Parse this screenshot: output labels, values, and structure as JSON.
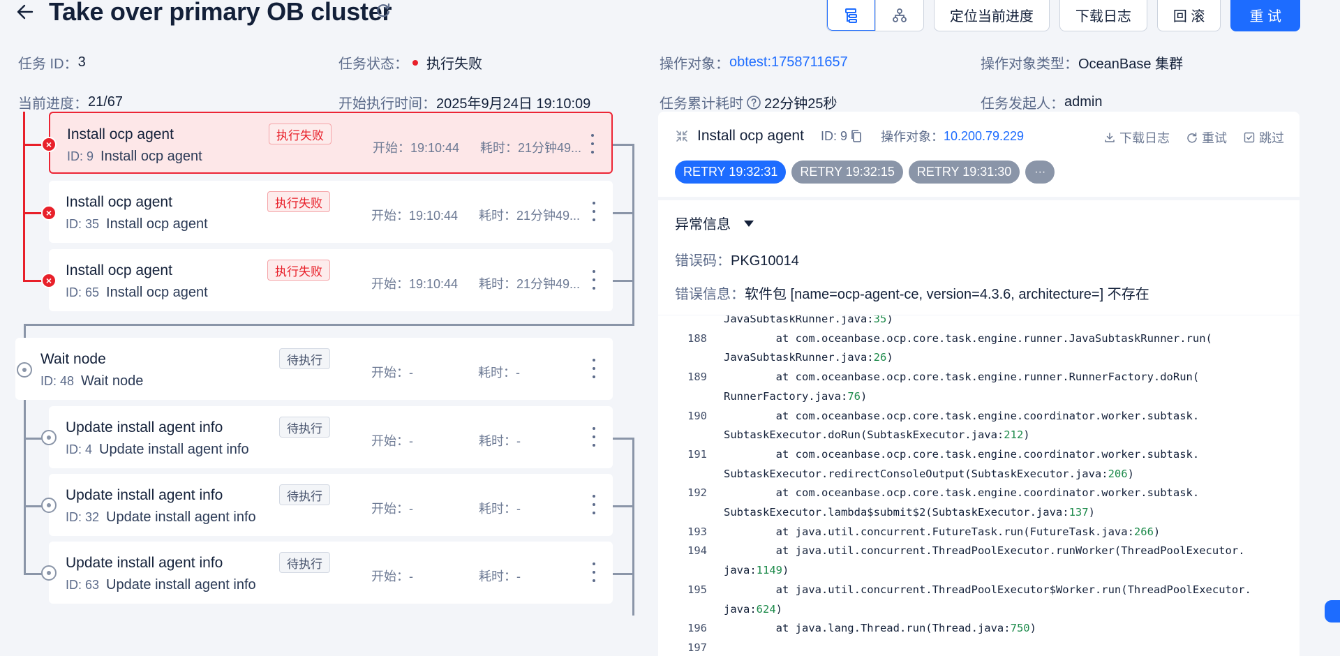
{
  "header": {
    "title": "Take over primary OB cluster",
    "buttons": {
      "locate": "定位当前进度",
      "download": "下载日志",
      "rollback": "回 滚",
      "retry": "重 试"
    }
  },
  "info": {
    "task_id_label": "任务 ID：",
    "task_id": "3",
    "status_label": "任务状态：",
    "status": "执行失败",
    "target_label": "操作对象：",
    "target": "obtest:1758711657",
    "target_type_label": "操作对象类型：",
    "target_type": "OceanBase 集群",
    "progress_label": "当前进度：",
    "progress": "21/67",
    "start_label": "开始执行时间：",
    "start": "2025年9月24日 19:10:09",
    "elapsed_label": "任务累计耗时",
    "elapsed": "22分钟25秒",
    "initiator_label": "任务发起人：",
    "initiator": "admin"
  },
  "tasks": [
    {
      "title": "Install ocp agent",
      "id": "ID: 9",
      "sub": "Install ocp agent",
      "tag": "执行失败",
      "start": "开始：19:10:44",
      "cost": "耗时：21分钟49..."
    },
    {
      "title": "Install ocp agent",
      "id": "ID: 35",
      "sub": "Install ocp agent",
      "tag": "执行失败",
      "start": "开始：19:10:44",
      "cost": "耗时：21分钟49..."
    },
    {
      "title": "Install ocp agent",
      "id": "ID: 65",
      "sub": "Install ocp agent",
      "tag": "执行失败",
      "start": "开始：19:10:44",
      "cost": "耗时：21分钟49..."
    },
    {
      "title": "Wait node",
      "id": "ID: 48",
      "sub": "Wait node",
      "tag": "待执行",
      "start": "开始：-",
      "cost": "耗时：-"
    },
    {
      "title": "Update install agent info",
      "id": "ID: 4",
      "sub": "Update install agent info",
      "tag": "待执行",
      "start": "开始：-",
      "cost": "耗时：-"
    },
    {
      "title": "Update install agent info",
      "id": "ID: 32",
      "sub": "Update install agent info",
      "tag": "待执行",
      "start": "开始：-",
      "cost": "耗时：-"
    },
    {
      "title": "Update install agent info",
      "id": "ID: 63",
      "sub": "Update install agent info",
      "tag": "待执行",
      "start": "开始：-",
      "cost": "耗时：-"
    }
  ],
  "subtask": {
    "name": "Install ocp agent",
    "id": "ID: 9",
    "target_label": "操作对象：",
    "target": "10.200.79.229",
    "actions": {
      "download": "下载日志",
      "retry": "重试",
      "skip": "跳过"
    },
    "retries": [
      "RETRY 19:32:31",
      "RETRY 19:32:15",
      "RETRY 19:31:30",
      "···"
    ]
  },
  "error": {
    "title": "异常信息",
    "code_label": "错误码：",
    "code": "PKG10014",
    "msg_label": "错误信息：",
    "msg": "软件包 [name=ocp-agent-ce, version=4.3.6, architecture=] 不存在"
  },
  "log": [
    {
      "n": "",
      "t": "JavaSubtaskRunner.java:",
      "num": "35",
      "e": ")"
    },
    {
      "n": "188",
      "t": "        at com.oceanbase.ocp.core.task.engine.runner.JavaSubtaskRunner.run(",
      "num": "",
      "e": ""
    },
    {
      "n": "",
      "t": "JavaSubtaskRunner.java:",
      "num": "26",
      "e": ")"
    },
    {
      "n": "189",
      "t": "        at com.oceanbase.ocp.core.task.engine.runner.RunnerFactory.doRun(",
      "num": "",
      "e": ""
    },
    {
      "n": "",
      "t": "RunnerFactory.java:",
      "num": "76",
      "e": ")"
    },
    {
      "n": "190",
      "t": "        at com.oceanbase.ocp.core.task.engine.coordinator.worker.subtask.",
      "num": "",
      "e": ""
    },
    {
      "n": "",
      "t": "SubtaskExecutor.doRun(SubtaskExecutor.java:",
      "num": "212",
      "e": ")"
    },
    {
      "n": "191",
      "t": "        at com.oceanbase.ocp.core.task.engine.coordinator.worker.subtask.",
      "num": "",
      "e": ""
    },
    {
      "n": "",
      "t": "SubtaskExecutor.redirectConsoleOutput(SubtaskExecutor.java:",
      "num": "206",
      "e": ")"
    },
    {
      "n": "192",
      "t": "        at com.oceanbase.ocp.core.task.engine.coordinator.worker.subtask.",
      "num": "",
      "e": ""
    },
    {
      "n": "",
      "t": "SubtaskExecutor.lambda$submit$2(SubtaskExecutor.java:",
      "num": "137",
      "e": ")"
    },
    {
      "n": "193",
      "t": "        at java.util.concurrent.FutureTask.run(FutureTask.java:",
      "num": "266",
      "e": ")"
    },
    {
      "n": "194",
      "t": "        at java.util.concurrent.ThreadPoolExecutor.runWorker(ThreadPoolExecutor.",
      "num": "",
      "e": ""
    },
    {
      "n": "",
      "t": "java:",
      "num": "1149",
      "e": ")"
    },
    {
      "n": "195",
      "t": "        at java.util.concurrent.ThreadPoolExecutor$Worker.run(ThreadPoolExecutor.",
      "num": "",
      "e": ""
    },
    {
      "n": "",
      "t": "java:",
      "num": "624",
      "e": ")"
    },
    {
      "n": "196",
      "t": "        at java.lang.Thread.run(Thread.java:",
      "num": "750",
      "e": ")"
    },
    {
      "n": "197",
      "t": "",
      "num": "",
      "e": ""
    }
  ]
}
